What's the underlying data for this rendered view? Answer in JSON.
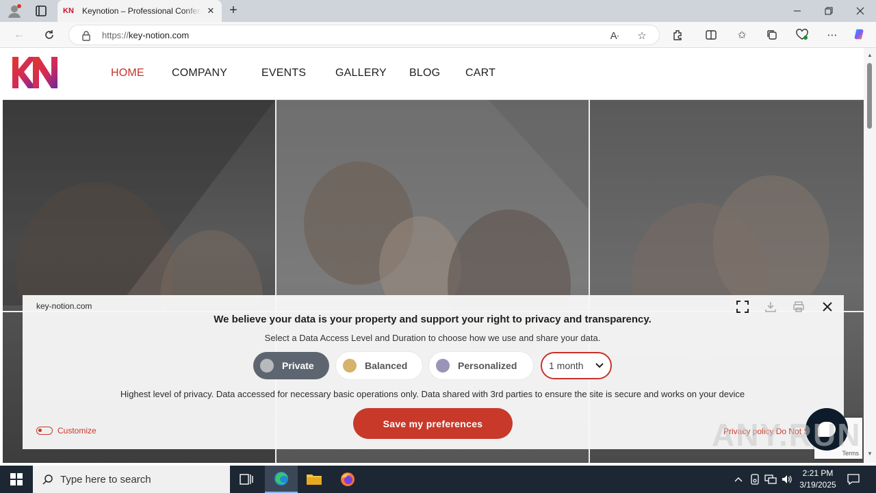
{
  "browser": {
    "tab_title": "Keynotion – Professional Conferences",
    "tab_favicon_text": "KN",
    "url_proto": "https://",
    "url_host": "key-notion.com"
  },
  "site": {
    "nav": [
      {
        "label": "HOME",
        "active": true
      },
      {
        "label": "COMPANY"
      },
      {
        "label": "EVENTS"
      },
      {
        "label": "GALLERY"
      },
      {
        "label": "BLOG"
      },
      {
        "label": "CART"
      }
    ]
  },
  "consent": {
    "domain": "key-notion.com",
    "headline": "We believe your data is your property and support your right to privacy and transparency.",
    "subtitle": "Select a Data Access Level and Duration to choose how we use and share your data.",
    "levels": [
      {
        "label": "Private",
        "color": "#b7b9bd",
        "selected": true
      },
      {
        "label": "Balanced",
        "color": "#d6b36a"
      },
      {
        "label": "Personalized",
        "color": "#9c93b8"
      }
    ],
    "duration": "1 month",
    "description": "Highest level of privacy. Data accessed for necessary basic operations only. Data shared with 3rd parties to ensure the site is secure and works on your device",
    "save_label": "Save my preferences",
    "customize_label": "Customize",
    "links": "Privacy policy   Do Not Sell",
    "accent": "#c8392a"
  },
  "recaptcha": {
    "terms": "Terms"
  },
  "watermark": "ANY.RUN",
  "taskbar": {
    "search_placeholder": "Type here to search",
    "time": "2:21 PM",
    "date": "3/19/2025"
  }
}
